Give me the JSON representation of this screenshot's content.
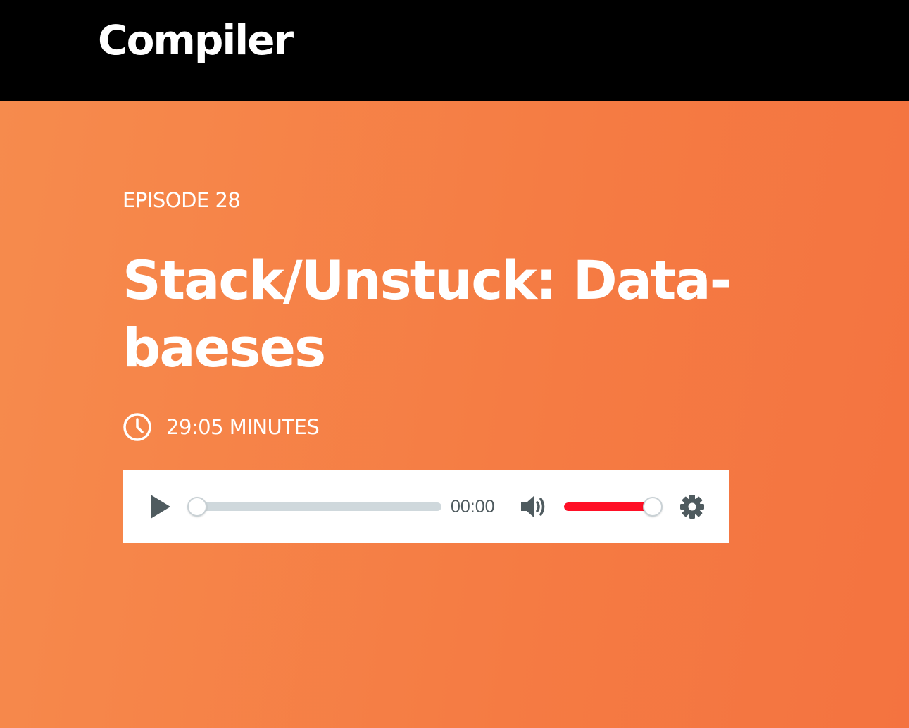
{
  "header": {
    "logo_text": "Compiler"
  },
  "episode": {
    "label": "EPISODE 28",
    "title": "Stack/Unstuck: Data-baeses",
    "duration": "29:05 MINUTES"
  },
  "player": {
    "current_time": "00:00",
    "progress_fraction": 0.0,
    "volume_fraction": 1.0,
    "icons": {
      "play": "play-icon",
      "volume": "volume-icon",
      "settings": "gear-icon",
      "duration": "clock-icon"
    }
  },
  "colors": {
    "header_bg": "#000000",
    "hero_bg": "#f5834a",
    "volume_accent": "#ff0f26",
    "track": "#cfd8dc",
    "player_icon": "#4f5b5f"
  }
}
